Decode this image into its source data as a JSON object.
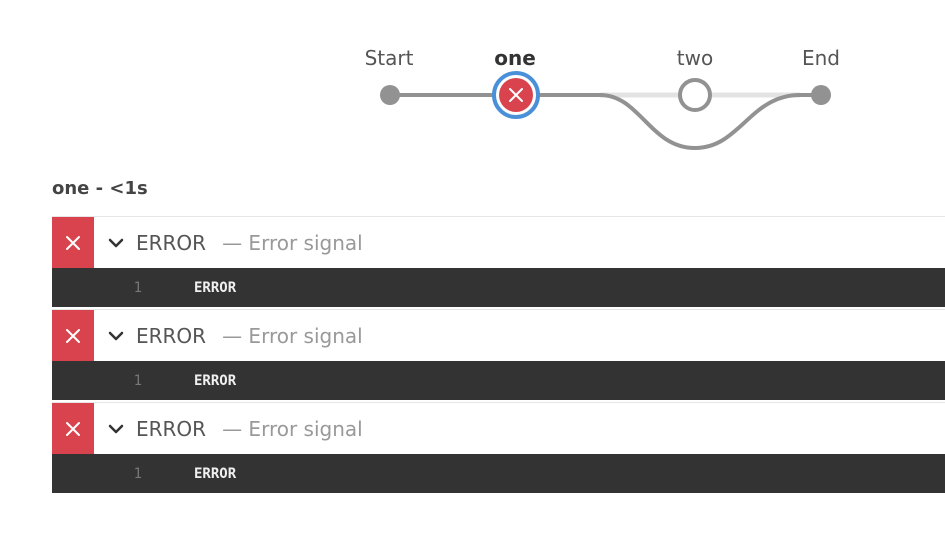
{
  "pipeline": {
    "stages": [
      {
        "name": "Start",
        "state": "terminal"
      },
      {
        "name": "one",
        "state": "failed",
        "selected": true
      },
      {
        "name": "two",
        "state": "not-built"
      },
      {
        "name": "End",
        "state": "terminal"
      }
    ]
  },
  "stage_heading": "one - <1s",
  "steps": [
    {
      "name": "ERROR",
      "description": "— Error signal",
      "status": "failed",
      "status_icon": "close-icon",
      "expand_icon": "chevron-down-icon",
      "log": [
        {
          "line": "1",
          "text": "ERROR"
        }
      ]
    },
    {
      "name": "ERROR",
      "description": "— Error signal",
      "status": "failed",
      "status_icon": "close-icon",
      "expand_icon": "chevron-down-icon",
      "log": [
        {
          "line": "1",
          "text": "ERROR"
        }
      ]
    },
    {
      "name": "ERROR",
      "description": "— Error signal",
      "status": "failed",
      "status_icon": "close-icon",
      "expand_icon": "chevron-down-icon",
      "log": [
        {
          "line": "1",
          "text": "ERROR"
        }
      ]
    }
  ],
  "colors": {
    "failed": "#d9434e",
    "selected_ring": "#4a90d9",
    "connector": "#929292",
    "log_background": "#333333"
  }
}
